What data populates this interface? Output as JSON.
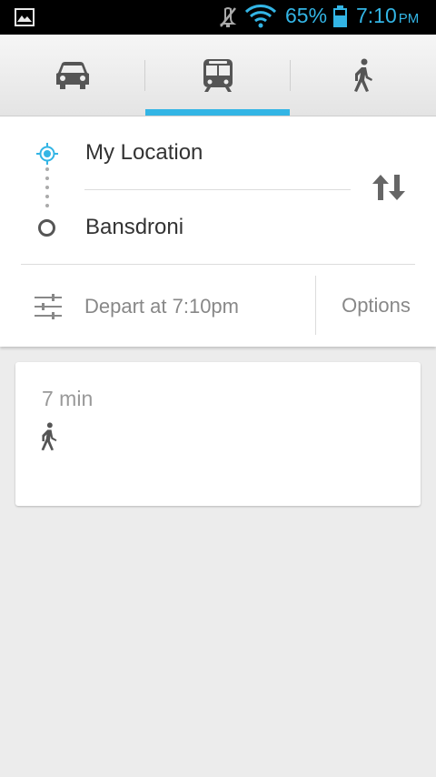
{
  "status_bar": {
    "battery_percent": "65%",
    "battery_level": 0.65,
    "time": "7:10",
    "ampm": "PM",
    "icons": [
      "gallery-icon",
      "mute-icon",
      "wifi-icon",
      "battery-icon"
    ]
  },
  "modes": [
    {
      "name": "car",
      "icon": "car-icon",
      "selected": false
    },
    {
      "name": "transit",
      "icon": "bus-icon",
      "selected": true
    },
    {
      "name": "walk",
      "icon": "walk-icon",
      "selected": false
    }
  ],
  "route": {
    "origin": "My Location",
    "destination": "Bansdroni",
    "depart": "Depart at 7:10pm",
    "options_label": "Options"
  },
  "results": [
    {
      "duration": "7 min",
      "icon": "walk-icon"
    }
  ],
  "colors": {
    "accent": "#33b5e5",
    "background": "#ececec",
    "status_bar": "#000000"
  }
}
